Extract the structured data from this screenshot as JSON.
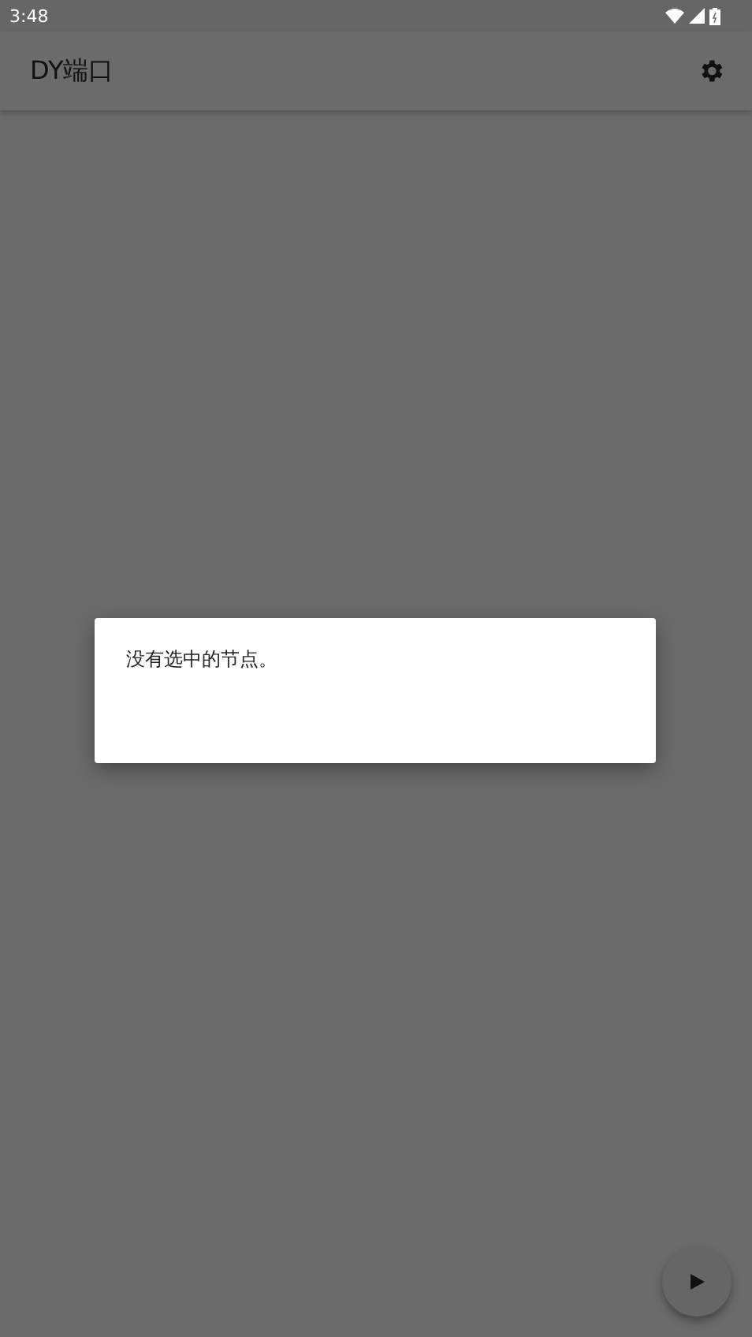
{
  "status_bar": {
    "time": "3:48"
  },
  "app_bar": {
    "title": "DY端口"
  },
  "dialog": {
    "message": "没有选中的节点。"
  }
}
